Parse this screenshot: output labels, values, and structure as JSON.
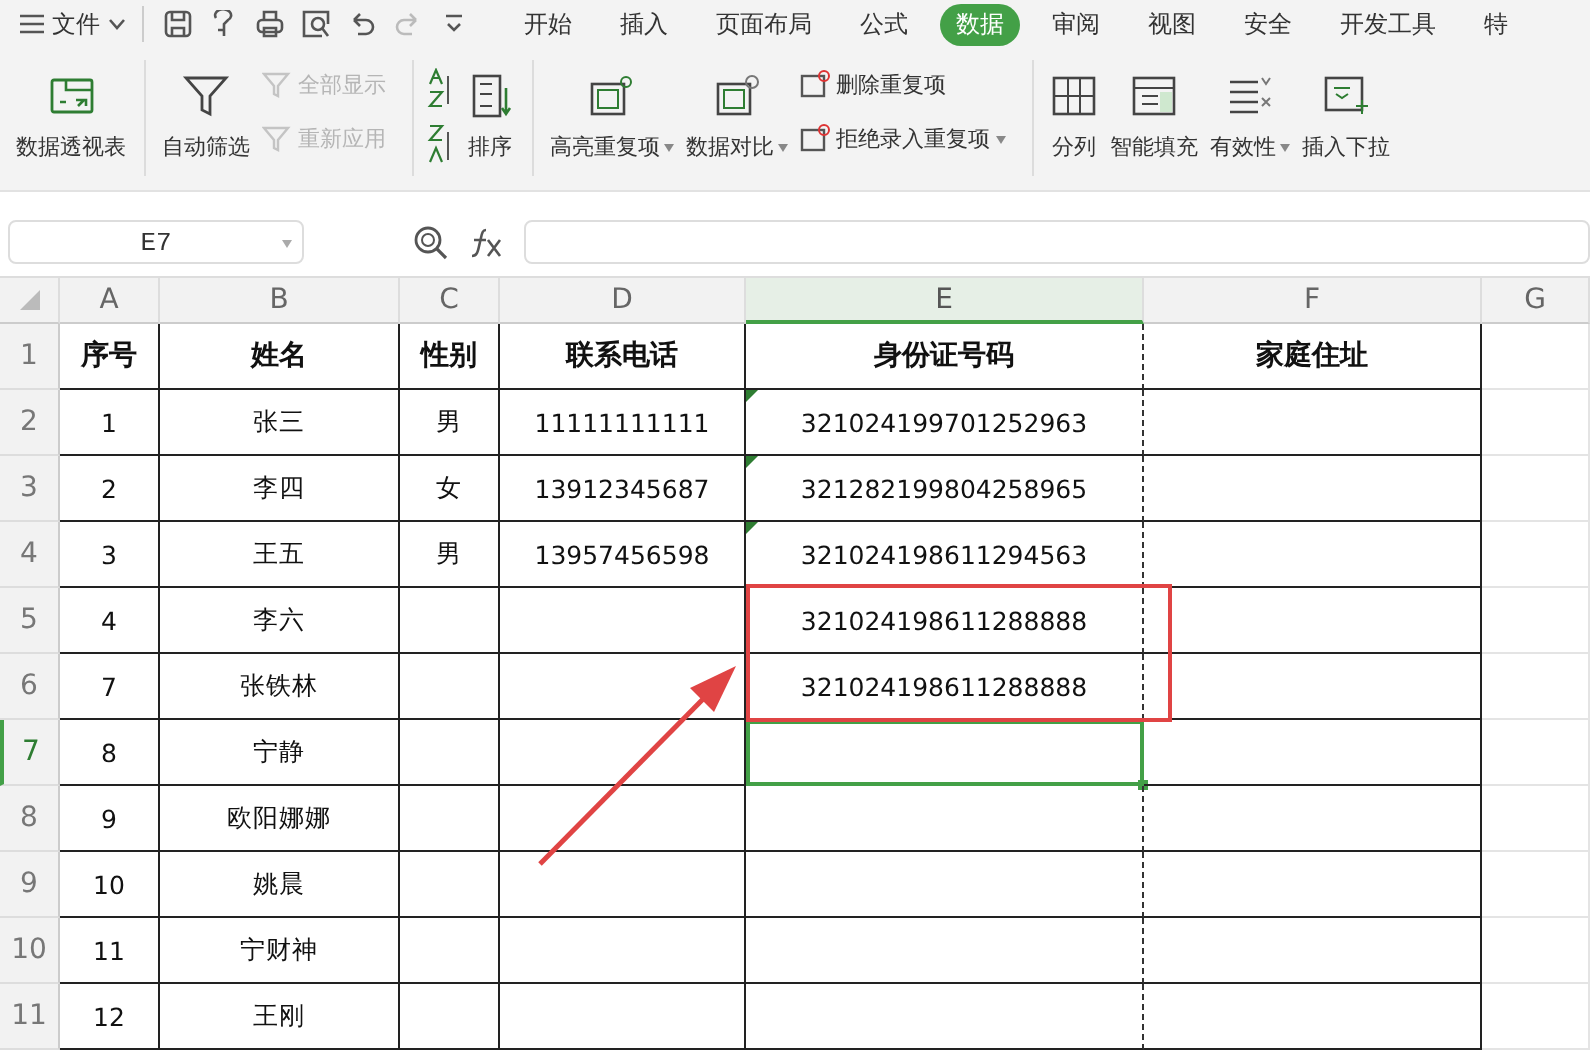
{
  "menubar": {
    "file_menu": "文件",
    "tabs": [
      {
        "label": "开始",
        "selected": false
      },
      {
        "label": "插入",
        "selected": false
      },
      {
        "label": "页面布局",
        "selected": false
      },
      {
        "label": "公式",
        "selected": false
      },
      {
        "label": "数据",
        "selected": true
      },
      {
        "label": "审阅",
        "selected": false
      },
      {
        "label": "视图",
        "selected": false
      },
      {
        "label": "安全",
        "selected": false
      },
      {
        "label": "开发工具",
        "selected": false
      },
      {
        "label": "特",
        "selected": false
      }
    ]
  },
  "ribbon": [
    {
      "kind": "large",
      "label": "数据透视表",
      "dropdown": false
    },
    {
      "kind": "separator"
    },
    {
      "kind": "large",
      "label": "自动筛选",
      "dropdown": false
    },
    {
      "kind": "stack",
      "items": [
        {
          "label": "全部显示",
          "disabled": true,
          "dropdown": false
        },
        {
          "label": "重新应用",
          "disabled": true,
          "dropdown": false
        }
      ]
    },
    {
      "kind": "separator"
    },
    {
      "kind": "sort_icons"
    },
    {
      "kind": "large",
      "label": "排序",
      "dropdown": false
    },
    {
      "kind": "separator"
    },
    {
      "kind": "large",
      "label": "高亮重复项",
      "dropdown": true
    },
    {
      "kind": "large",
      "label": "数据对比",
      "dropdown": true
    },
    {
      "kind": "stack",
      "items": [
        {
          "label": "删除重复项",
          "disabled": false,
          "dropdown": false
        },
        {
          "label": "拒绝录入重复项",
          "disabled": false,
          "dropdown": true
        }
      ]
    },
    {
      "kind": "separator"
    },
    {
      "kind": "large",
      "label": "分列",
      "dropdown": false
    },
    {
      "kind": "large",
      "label": "智能填充",
      "dropdown": false
    },
    {
      "kind": "large",
      "label": "有效性",
      "dropdown": true
    },
    {
      "kind": "large",
      "label": "插入下拉",
      "dropdown": false
    }
  ],
  "formula_bar": {
    "name_box": "E7"
  },
  "sheet": {
    "columns": [
      {
        "label": "A",
        "selected": false
      },
      {
        "label": "B",
        "selected": false
      },
      {
        "label": "C",
        "selected": false
      },
      {
        "label": "D",
        "selected": false
      },
      {
        "label": "E",
        "selected": true
      },
      {
        "label": "F",
        "selected": false
      },
      {
        "label": "G",
        "selected": false
      }
    ],
    "rows": [
      {
        "number": "1",
        "selected": false,
        "header": true,
        "text_number_flag": false,
        "cells": [
          "序号",
          "姓名",
          "性别",
          "联系电话",
          "身份证号码",
          "家庭住址"
        ]
      },
      {
        "number": "2",
        "selected": false,
        "header": false,
        "text_number_flag": true,
        "cells": [
          "1",
          "张三",
          "男",
          "11111111111",
          "321024199701252963",
          ""
        ]
      },
      {
        "number": "3",
        "selected": false,
        "header": false,
        "text_number_flag": true,
        "cells": [
          "2",
          "李四",
          "女",
          "13912345687",
          "321282199804258965",
          ""
        ]
      },
      {
        "number": "4",
        "selected": false,
        "header": false,
        "text_number_flag": true,
        "cells": [
          "3",
          "王五",
          "男",
          "13957456598",
          "321024198611294563",
          ""
        ]
      },
      {
        "number": "5",
        "selected": false,
        "header": false,
        "text_number_flag": false,
        "cells": [
          "4",
          "李六",
          "",
          "",
          "321024198611288888",
          ""
        ]
      },
      {
        "number": "6",
        "selected": false,
        "header": false,
        "text_number_flag": false,
        "cells": [
          "7",
          "张铁林",
          "",
          "",
          "321024198611288888",
          ""
        ]
      },
      {
        "number": "7",
        "selected": true,
        "header": false,
        "text_number_flag": false,
        "cells": [
          "8",
          "宁静",
          "",
          "",
          "",
          ""
        ]
      },
      {
        "number": "8",
        "selected": false,
        "header": false,
        "text_number_flag": false,
        "cells": [
          "9",
          "欧阳娜娜",
          "",
          "",
          "",
          ""
        ]
      },
      {
        "number": "9",
        "selected": false,
        "header": false,
        "text_number_flag": false,
        "cells": [
          "10",
          "姚晨",
          "",
          "",
          "",
          ""
        ]
      },
      {
        "number": "10",
        "selected": false,
        "header": false,
        "text_number_flag": false,
        "cells": [
          "11",
          "宁财神",
          "",
          "",
          "",
          ""
        ]
      },
      {
        "number": "11",
        "selected": false,
        "header": false,
        "text_number_flag": false,
        "cells": [
          "12",
          "王刚",
          "",
          "",
          "",
          ""
        ]
      }
    ]
  }
}
